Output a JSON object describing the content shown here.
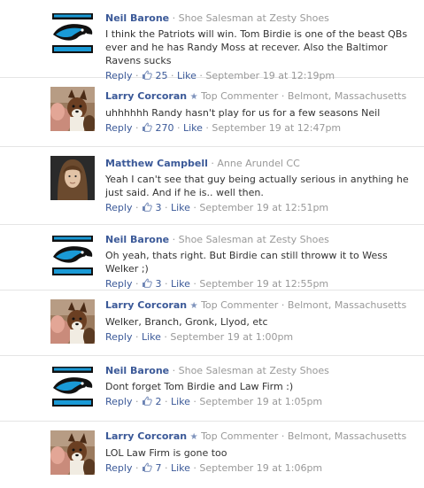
{
  "ui": {
    "reply": "Reply",
    "like": "Like",
    "dot": "·"
  },
  "comments": [
    {
      "author": "Neil Barone",
      "subtitle": "Shoe Salesman at Zesty Shoes",
      "badge": "",
      "location": "",
      "text": "I think the Patriots will win. Tom Birdie is one of the beast QBs ever and he has Randy Moss at recever. Also the Baltimor Ravens sucks",
      "likes": "25",
      "time": "September 19 at 12:19pm",
      "avatar": "panthers-logo"
    },
    {
      "author": "Larry Corcoran",
      "subtitle": "",
      "badge": "Top Commenter",
      "location": "Belmont, Massachusetts",
      "text": "uhhhhhh Randy hasn't play for us for a few seasons Neil",
      "likes": "270",
      "time": "September 19 at 12:47pm",
      "avatar": "dog-photo"
    },
    {
      "author": "Matthew Campbell",
      "subtitle": "Anne Arundel CC",
      "badge": "",
      "location": "",
      "text": "Yeah I can't see that guy being actually serious in anything he just said. And if he is.. well then.",
      "likes": "3",
      "time": "September 19 at 12:51pm",
      "avatar": "person-photo"
    },
    {
      "author": "Neil Barone",
      "subtitle": "Shoe Salesman at Zesty Shoes",
      "badge": "",
      "location": "",
      "text": "Oh yeah, thats right. But Birdie can still throww it to Wess Welker ;)",
      "likes": "3",
      "time": "September 19 at 12:55pm",
      "avatar": "panthers-logo"
    },
    {
      "author": "Larry Corcoran",
      "subtitle": "",
      "badge": "Top Commenter",
      "location": "Belmont, Massachusetts",
      "text": "Welker, Branch, Gronk, Llyod, etc",
      "likes": "",
      "time": "September 19 at 1:00pm",
      "avatar": "dog-photo"
    },
    {
      "author": "Neil Barone",
      "subtitle": "Shoe Salesman at Zesty Shoes",
      "badge": "",
      "location": "",
      "text": "Dont forget Tom Birdie and Law Firm :)",
      "likes": "2",
      "time": "September 19 at 1:05pm",
      "avatar": "panthers-logo"
    },
    {
      "author": "Larry Corcoran",
      "subtitle": "",
      "badge": "Top Commenter",
      "location": "Belmont, Massachusetts",
      "text": "LOL Law Firm is gone too",
      "likes": "7",
      "time": "September 19 at 1:06pm",
      "avatar": "dog-photo"
    }
  ]
}
